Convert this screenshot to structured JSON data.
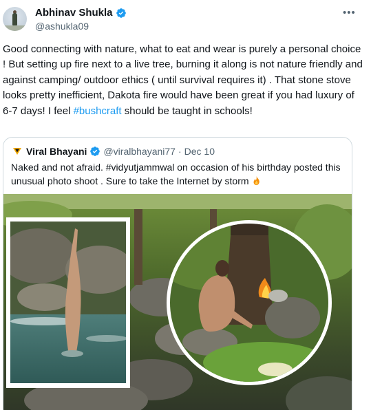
{
  "tweet": {
    "display_name": "Abhinav Shukla",
    "handle": "@ashukla09",
    "more_label": "•••",
    "text_before_hashtag": "Good connecting with nature, what to eat and wear is purely a personal choice ! But setting up fire next to a live tree, burning it along is not nature friendly and against camping/ outdoor ethics ( until survival requires it) . That stone stove  looks pretty inefficient, Dakota fire would have been great if you had luxury of 6-7 days! I feel ",
    "hashtag": "#bushcraft",
    "text_after_hashtag": " should be taught in schools!",
    "verified_icon": "verified-badge-icon",
    "accent_color": "#1d9bf0"
  },
  "quote": {
    "display_name": "Viral Bhayani",
    "handle": "@viralbhayani77",
    "separator": "·",
    "date": "Dec 10",
    "text": "Naked and not afraid. #vidyutjammwal on occasion of his birthday posted this unusual photo shoot . Sure to take the Internet by storm ",
    "emoji_icon": "fire-emoji-icon",
    "media_icon": "photo-collage"
  }
}
